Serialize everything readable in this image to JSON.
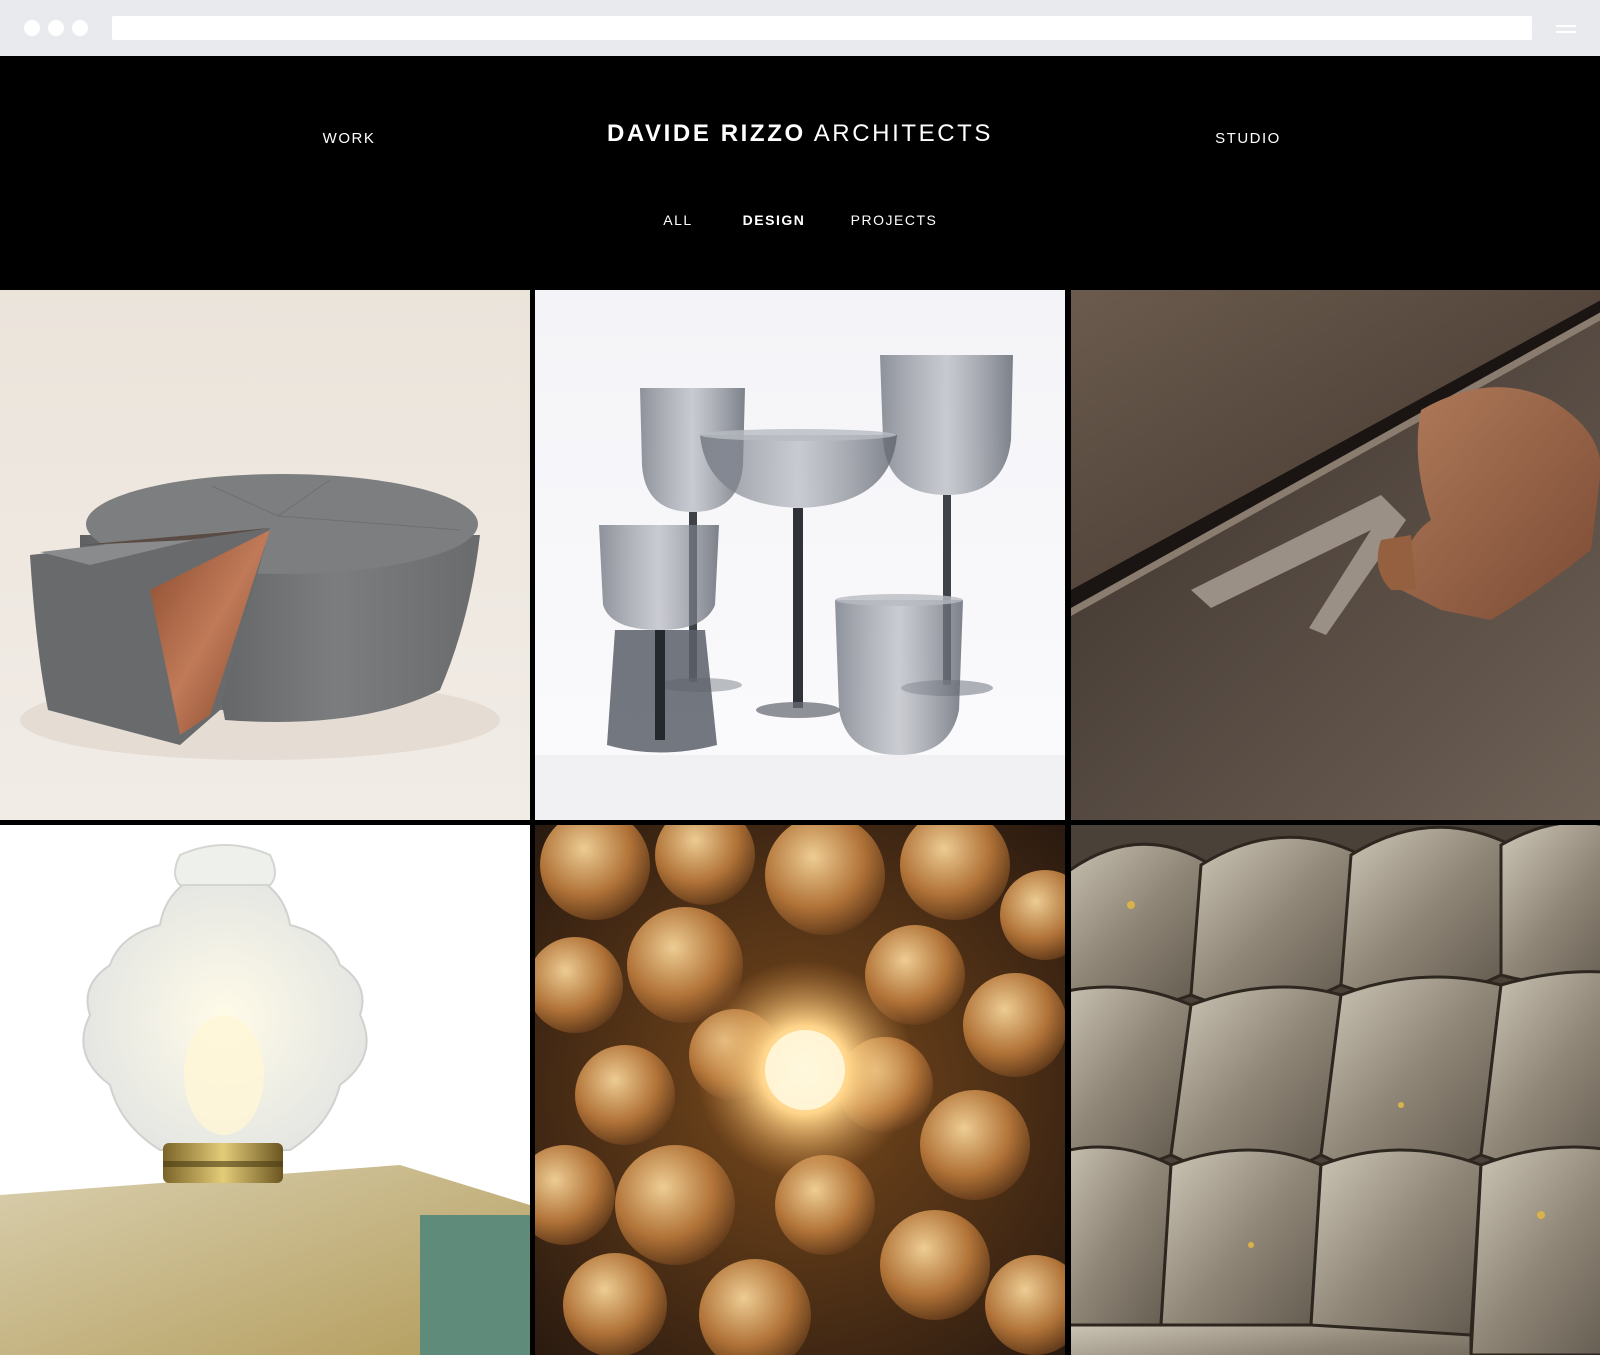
{
  "browser": {
    "address": "",
    "menu_icon": "hamburger-icon"
  },
  "header": {
    "logo_bold": "DAVIDE RIZZO",
    "logo_light": "ARCHITECTS",
    "nav_left": "WORK",
    "nav_right": "STUDIO"
  },
  "filters": {
    "items": [
      "ALL",
      "DESIGN",
      "PROJECTS"
    ],
    "active": "DESIGN"
  },
  "gallery": {
    "tiles": [
      {
        "subject": "segmented-table"
      },
      {
        "subject": "glassware"
      },
      {
        "subject": "drawer-handle"
      },
      {
        "subject": "glass-lamp"
      },
      {
        "subject": "glass-spheres"
      },
      {
        "subject": "scale-tiles"
      }
    ]
  },
  "colors": {
    "background": "#000000",
    "text": "#ffffff",
    "chrome": "#e8eaed"
  }
}
